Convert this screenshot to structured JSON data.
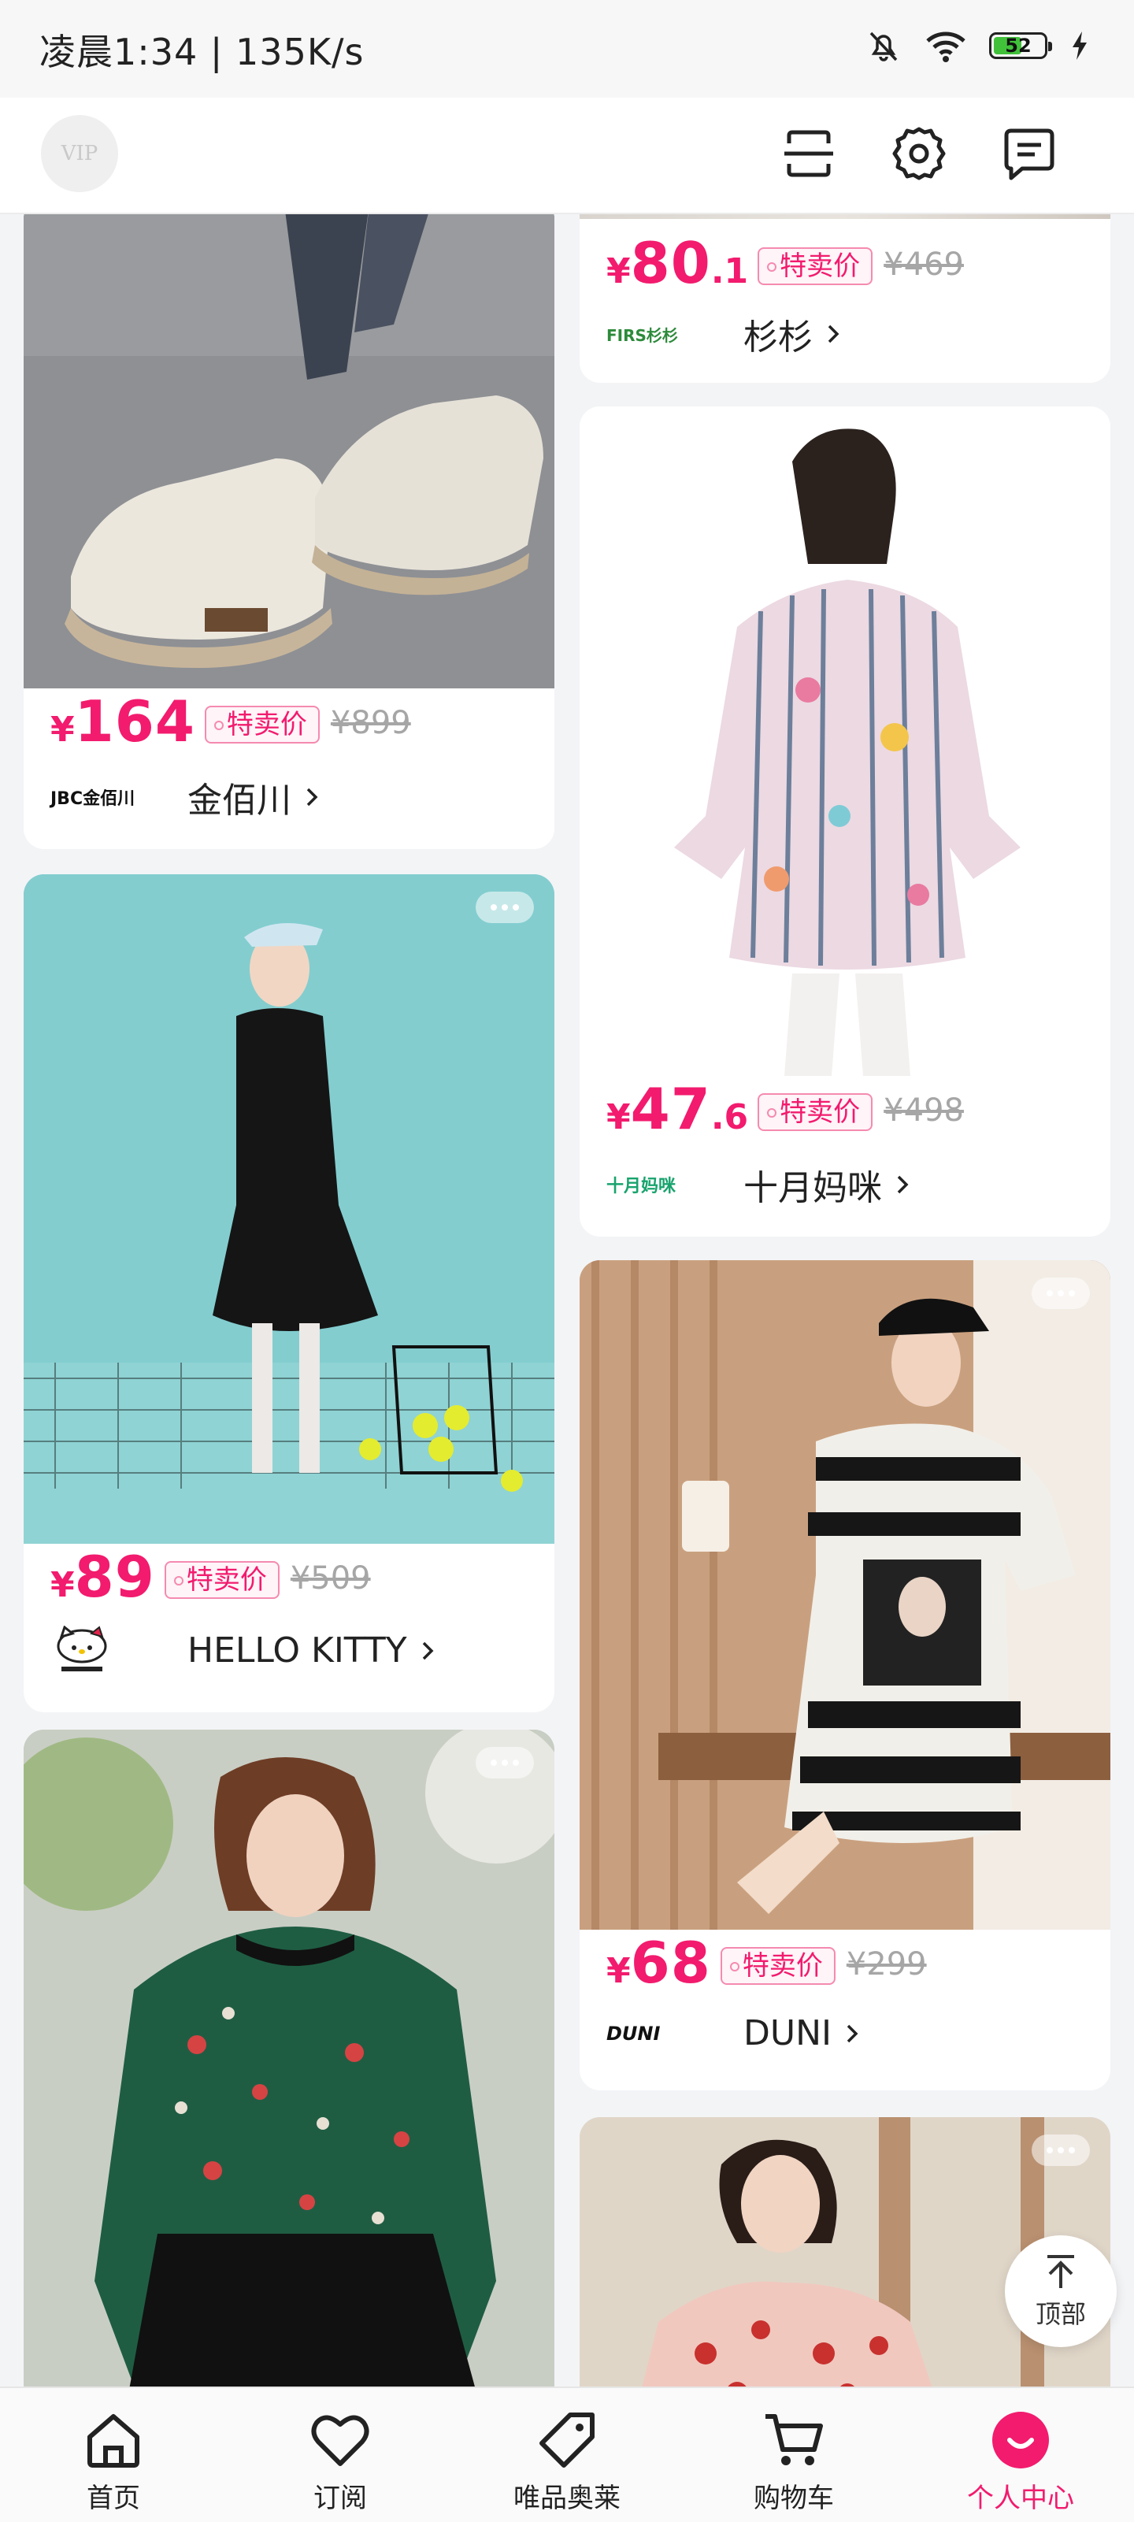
{
  "status_bar": {
    "time": "凌晨1:34 | 135K/s",
    "battery": "52"
  },
  "header": {
    "vip_label": "VIP"
  },
  "products": [
    {
      "price_int": "80",
      "price_dec": ".1",
      "tag": "特卖价",
      "original": "¥469",
      "brand_logo": "FIRS杉杉",
      "brand": "杉杉",
      "image_hint": "top-crop"
    },
    {
      "price_int": "164",
      "price_dec": "",
      "tag": "特卖价",
      "original": "¥899",
      "brand_logo": "JBC金佰川",
      "brand": "金佰川",
      "image_hint": "white-sneakers"
    },
    {
      "price_int": "47",
      "price_dec": ".6",
      "tag": "特卖价",
      "original": "¥498",
      "brand_logo": "十月妈咪",
      "brand": "十月妈咪",
      "image_hint": "floral-blouse"
    },
    {
      "price_int": "89",
      "price_dec": "",
      "tag": "特卖价",
      "original": "¥509",
      "brand_logo": "HELLO KITTY",
      "brand": "HELLO KITTY",
      "image_hint": "black-tennis-dress"
    },
    {
      "price_int": "68",
      "price_dec": "",
      "tag": "特卖价",
      "original": "¥299",
      "brand_logo": "DUNI",
      "brand": "DUNI",
      "image_hint": "striped-dress"
    }
  ],
  "currency": "¥",
  "back_to_top": "顶部",
  "tabbar": [
    {
      "label": "首页",
      "icon": "home-icon"
    },
    {
      "label": "订阅",
      "icon": "heart-icon"
    },
    {
      "label": "唯品奥莱",
      "icon": "tag-icon"
    },
    {
      "label": "购物车",
      "icon": "cart-icon"
    },
    {
      "label": "个人中心",
      "icon": "profile-icon"
    }
  ],
  "colors": {
    "accent": "#f21b6e",
    "active_tab": "#f21b6e"
  }
}
